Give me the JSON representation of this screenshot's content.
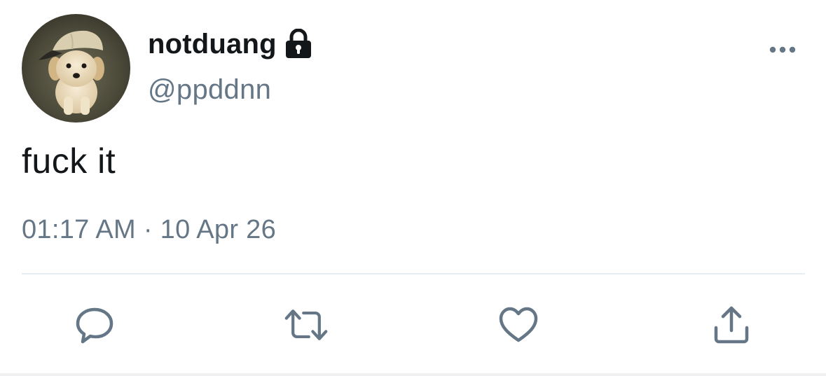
{
  "tweet": {
    "author": {
      "display_name": "notduang",
      "handle": "@ppddnn",
      "protected_icon": "lock-icon",
      "avatar": "puppy-wearing-cap"
    },
    "text": "fuck it",
    "time": "01:17 AM",
    "separator": "·",
    "date": "10 Apr 26",
    "more_icon": "more-horizontal-icon"
  },
  "actions": [
    {
      "name": "reply",
      "icon": "reply-icon"
    },
    {
      "name": "retweet",
      "icon": "retweet-icon"
    },
    {
      "name": "like",
      "icon": "heart-icon"
    },
    {
      "name": "share",
      "icon": "share-icon"
    }
  ],
  "colors": {
    "primary_text": "#14171a",
    "secondary_text": "#657786",
    "divider": "#e6ecf0",
    "icon": "#657786"
  }
}
